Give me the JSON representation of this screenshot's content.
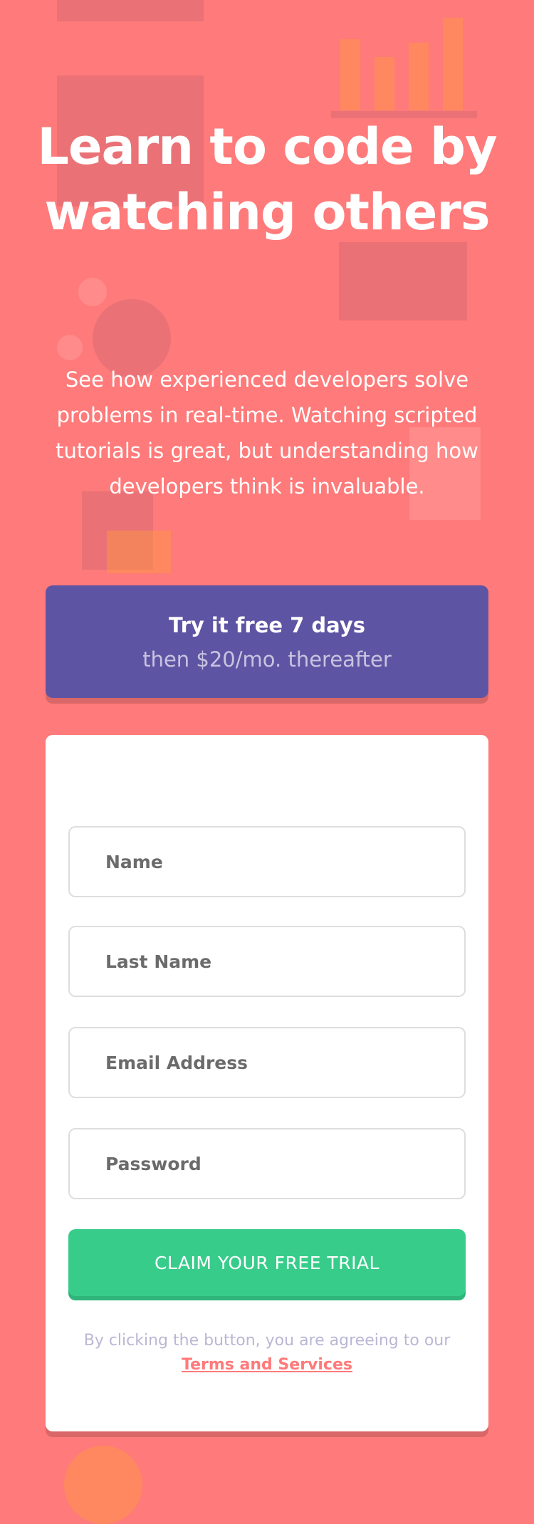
{
  "hero": {
    "title": "Learn to code by watching others",
    "description": "See how experienced developers solve problems in real-time. Watching scripted tutorials is great, but understanding how developers think is invaluable."
  },
  "pricing": {
    "headline": "Try it free 7 days",
    "subline": "then $20/mo. thereafter"
  },
  "form": {
    "fields": [
      {
        "placeholder": "Name",
        "value": ""
      },
      {
        "placeholder": "Last Name",
        "value": ""
      },
      {
        "placeholder": "Email Address",
        "value": ""
      },
      {
        "placeholder": "Password",
        "value": ""
      }
    ],
    "submit_label": "CLAIM YOUR FREE TRIAL",
    "terms_prefix": "By clicking the button, you are agreeing to our",
    "terms_link": "Terms and Services"
  },
  "colors": {
    "background": "#ff7a7a",
    "banner": "#5e54a4",
    "button": "#38cc8b",
    "card": "#ffffff",
    "muted_text": "#bab7d4"
  }
}
